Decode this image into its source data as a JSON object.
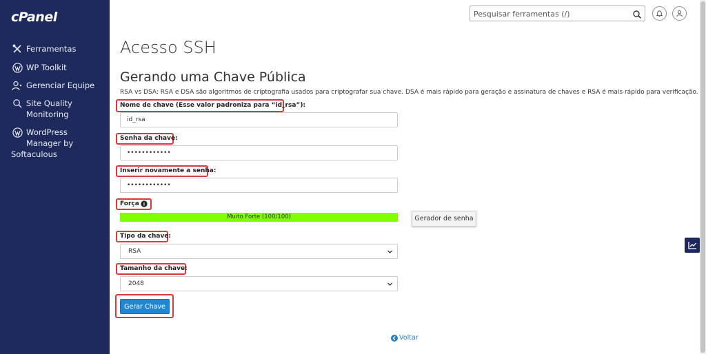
{
  "brand": {
    "logo_text": "cPanel"
  },
  "sidebar": {
    "items": [
      {
        "label": "Ferramentas",
        "icon": "tools-icon"
      },
      {
        "label": "WP Toolkit",
        "icon": "wordpress-icon"
      },
      {
        "label": "Gerenciar Equipe",
        "icon": "team-icon"
      },
      {
        "label": "Site Quality\nMonitoring",
        "icon": "site-quality-icon"
      },
      {
        "label": "WordPress\n Manager by",
        "icon": "wordpress-icon"
      }
    ],
    "softaculous_line": "Softaculous"
  },
  "header": {
    "search_placeholder": "Pesquisar ferramentas (/)",
    "notifications_icon": "bell-icon",
    "user_icon": "user-icon"
  },
  "page": {
    "title": "Acesso SSH",
    "section_title": "Gerando uma Chave Pública",
    "description": "RSA vs DSA: RSA e DSA são algoritmos de criptografia usados para criptografar sua chave. DSA é mais rápido para geração e assinatura de chaves e RSA é mais rápido para verificação."
  },
  "form": {
    "key_name_label": "Nome de chave (Esse valor padroniza para “id_rsa”):",
    "key_name_value": "id_rsa",
    "password_label": "Senha da chave:",
    "password_value": "••••••••••••",
    "confirm_label": "Inserir novamente a senha:",
    "confirm_value": "••••••••••••",
    "strength_label": "Força",
    "strength_text": "Muito Forte (100/100)",
    "strength_percent": 100,
    "password_generator_button": "Gerador de senha",
    "key_type_label": "Tipo da chave:",
    "key_type_value": "RSA",
    "key_size_label": "Tamanho da chave:",
    "key_size_value": "2048",
    "submit_button": "Gerar Chave"
  },
  "footer": {
    "back_link": "Voltar"
  },
  "colors": {
    "sidebar_bg": "#1f2a5c",
    "accent_blue": "#1f88d6",
    "strength_green": "#80ff00",
    "highlight_red": "#d8393b"
  }
}
